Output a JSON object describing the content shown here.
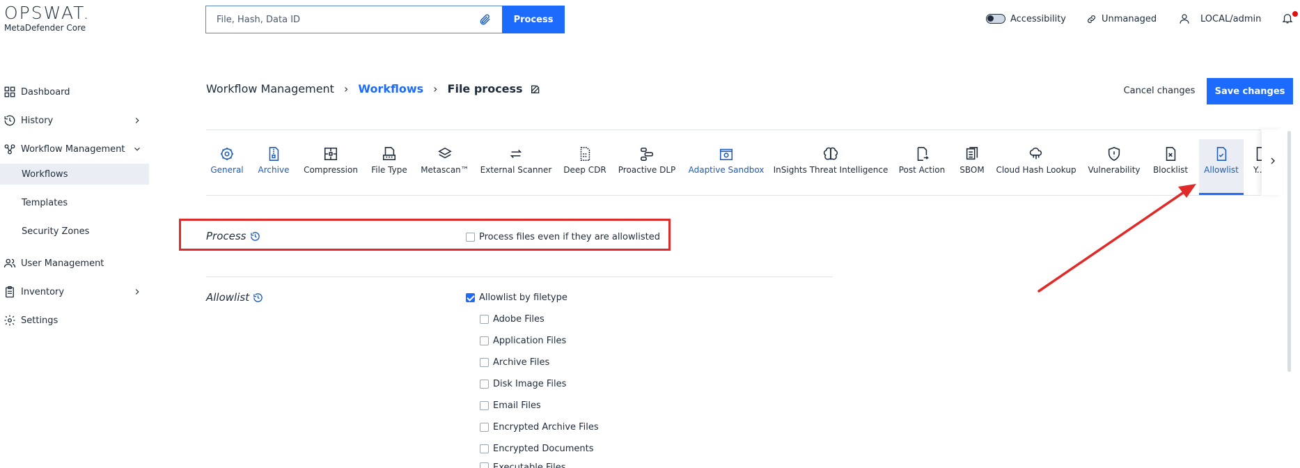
{
  "brand": {
    "name": "OPSWAT.",
    "product": "MetaDefender Core"
  },
  "search": {
    "placeholder": "File, Hash, Data ID",
    "button": "Process"
  },
  "topbar": {
    "accessibility": "Accessibility",
    "unmanaged": "Unmanaged",
    "user": "LOCAL/admin"
  },
  "sidebar": {
    "items": [
      "Dashboard",
      "History",
      "Workflow Management",
      "User Management",
      "Inventory",
      "Settings"
    ],
    "sub": [
      "Workflows",
      "Templates",
      "Security Zones"
    ]
  },
  "breadcrumb": {
    "root": "Workflow Management",
    "mid": "Workflows",
    "current": "File process"
  },
  "actions": {
    "cancel": "Cancel changes",
    "save": "Save changes"
  },
  "tabs": [
    "General",
    "Archive",
    "Compression",
    "File Type",
    "Metascan™",
    "External Scanner",
    "Deep CDR",
    "Proactive DLP",
    "Adaptive Sandbox",
    "InSights Threat Intelligence",
    "Post Action",
    "SBOM",
    "Cloud Hash Lookup",
    "Vulnerability",
    "Blocklist",
    "Allowlist",
    "Y..."
  ],
  "process": {
    "label": "Process",
    "option": "Process files even if they are allowlisted"
  },
  "allowlist": {
    "label": "Allowlist",
    "by_filetype": "Allowlist by filetype",
    "types": [
      "Adobe Files",
      "Application Files",
      "Archive Files",
      "Disk Image Files",
      "Email Files",
      "Encrypted Archive Files",
      "Encrypted Documents",
      "Executable Files"
    ]
  },
  "colors": {
    "accent": "#1d6bfc",
    "highlight": "#e02a2a"
  }
}
